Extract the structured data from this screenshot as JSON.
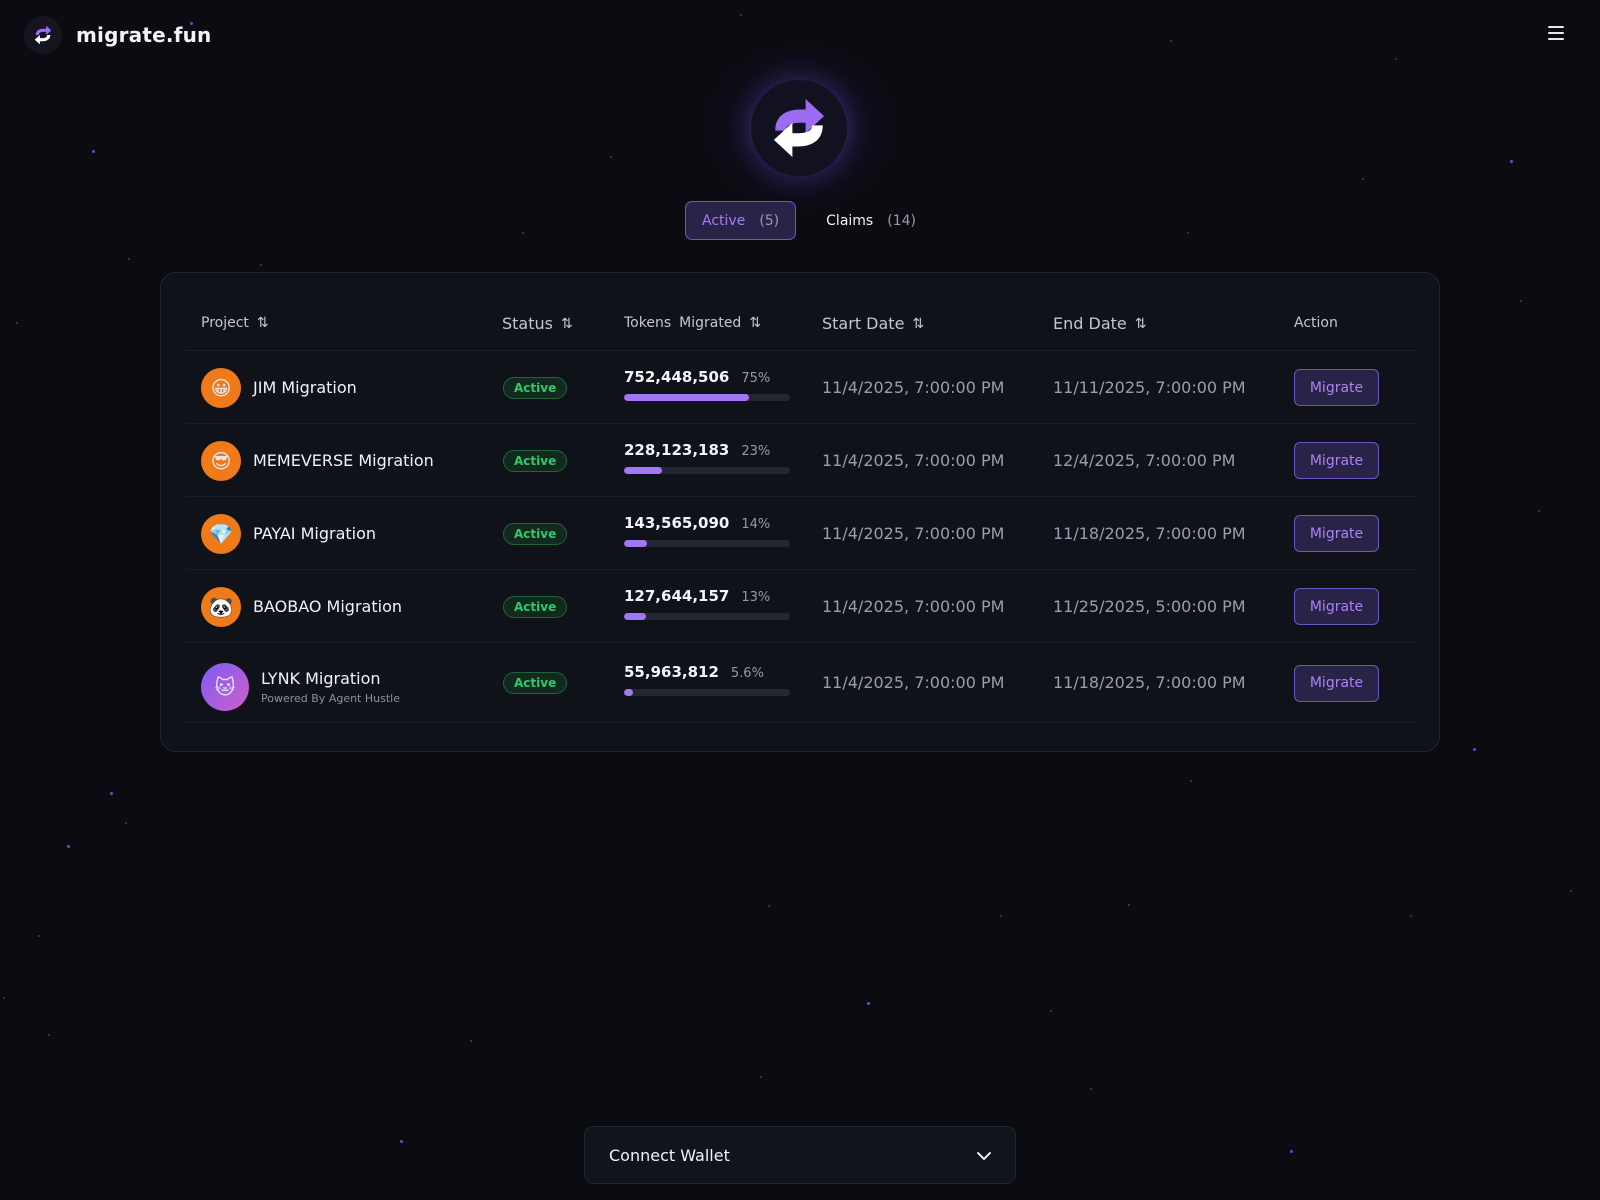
{
  "brand": {
    "name": "migrate.fun",
    "logo_icon": "swap-arrows-icon"
  },
  "menu": {
    "icon": "hamburger-menu-icon"
  },
  "hero": {
    "logo_icon": "swap-arrows-icon"
  },
  "tabs": [
    {
      "label": "Active",
      "count": "(5)",
      "selected": true
    },
    {
      "label": "Claims",
      "count": "(14)",
      "selected": false
    }
  ],
  "table": {
    "columns": {
      "project": "Project",
      "status": "Status",
      "tokens_a": "Tokens",
      "tokens_b": "Migrated",
      "start": "Start Date",
      "end": "End Date",
      "action": "Action"
    },
    "rows": [
      {
        "emoji": "😀",
        "name": "JIM Migration",
        "sub": "",
        "status": "Active",
        "tokens": "752,448,506",
        "pct": "75%",
        "fill": 0.75,
        "start": "11/4/2025, 7:00:00 PM",
        "end": "11/11/2025, 7:00:00 PM",
        "action": "Migrate"
      },
      {
        "emoji": "😎",
        "name": "MEMEVERSE Migration",
        "sub": "",
        "status": "Active",
        "tokens": "228,123,183",
        "pct": "23%",
        "fill": 0.23,
        "start": "11/4/2025, 7:00:00 PM",
        "end": "12/4/2025, 7:00:00 PM",
        "action": "Migrate"
      },
      {
        "emoji": "💎",
        "name": "PAYAI Migration",
        "sub": "",
        "status": "Active",
        "tokens": "143,565,090",
        "pct": "14%",
        "fill": 0.14,
        "start": "11/4/2025, 7:00:00 PM",
        "end": "11/18/2025, 7:00:00 PM",
        "action": "Migrate"
      },
      {
        "emoji": "🐼",
        "name": "BAOBAO Migration",
        "sub": "",
        "status": "Active",
        "tokens": "127,644,157",
        "pct": "13%",
        "fill": 0.13,
        "start": "11/4/2025, 7:00:00 PM",
        "end": "11/25/2025, 5:00:00 PM",
        "action": "Migrate"
      },
      {
        "emoji": "🐱",
        "name": "LYNK Migration",
        "sub": "Powered By Agent Hustle",
        "status": "Active",
        "tokens": "55,963,812",
        "pct": "5.6%",
        "fill": 0.056,
        "start": "11/4/2025, 7:00:00 PM",
        "end": "11/18/2025, 7:00:00 PM",
        "action": "Migrate"
      }
    ]
  },
  "wallet": {
    "label": "Connect Wallet",
    "icon": "chevron-down-icon"
  },
  "colors": {
    "accent": "#a277f6",
    "background": "#0b0c12",
    "status_green": "#32c86a"
  }
}
